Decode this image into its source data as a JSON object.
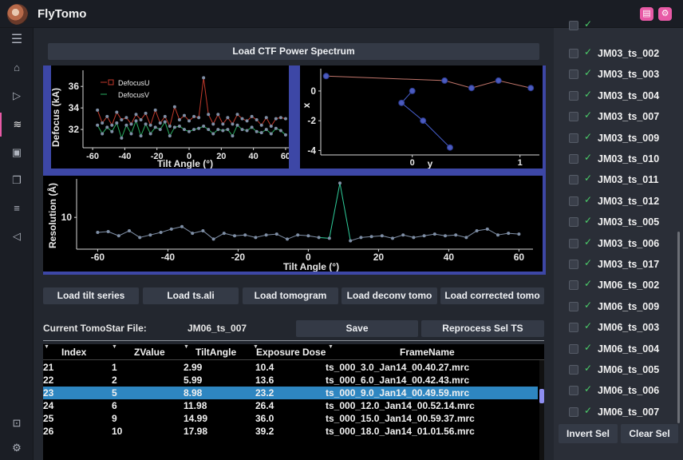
{
  "app": {
    "title": "FlyTomo"
  },
  "header": {
    "icons": [
      "notes-icon",
      "settings-icon"
    ]
  },
  "sidebar": {
    "icons": [
      "menu-icon",
      "home-icon",
      "play-icon",
      "feed-icon",
      "gallery-icon",
      "copy-icon",
      "list-icon",
      "send-icon",
      "save-icon",
      "gear-icon"
    ]
  },
  "main": {
    "load_ctf_label": "Load CTF Power Spectrum",
    "buttons": {
      "load_tilt_series": "Load tilt series",
      "load_ts_ali": "Load ts.ali",
      "load_tomogram": "Load tomogram",
      "load_deconv_tomo": "Load deconv tomo",
      "load_corrected_tomo": "Load corrected tomo",
      "save": "Save",
      "reprocess": "Reprocess Sel TS"
    },
    "current_file_label": "Current TomoStar File:",
    "current_file_value": "JM06_ts_007"
  },
  "defocus_plot": {
    "ylabel": "Defocus (kA)",
    "xlabel": "Tilt Angle (°)",
    "xticks": [
      "-60",
      "-40",
      "-20",
      "0",
      "20",
      "40",
      "60"
    ],
    "yticks": [
      "32",
      "34",
      "36"
    ],
    "legend": [
      "DefocusU",
      "DefocusV"
    ]
  },
  "xy_plot": {
    "xlabel": "y",
    "ylabel": "x",
    "xticks": [
      "0",
      "1"
    ],
    "yticks": [
      "0",
      "-2",
      "-4"
    ]
  },
  "resolution_plot": {
    "ylabel": "Resolution (Å)",
    "xlabel": "Tilt Angle (°)",
    "xticks": [
      "-60",
      "-40",
      "-20",
      "0",
      "20",
      "40",
      "60"
    ],
    "yticks": [
      "10"
    ]
  },
  "table": {
    "headers": [
      "Index",
      "ZValue",
      "TiltAngle",
      "Exposure Dose",
      "FrameName"
    ],
    "rows": [
      {
        "index": "21",
        "z": "1",
        "tilt": "2.99",
        "dose": "10.4",
        "frame": "ts_000_3.0_Jan14_00.40.27.mrc",
        "selected": false
      },
      {
        "index": "22",
        "z": "2",
        "tilt": "5.99",
        "dose": "13.6",
        "frame": "ts_000_6.0_Jan14_00.42.43.mrc",
        "selected": false
      },
      {
        "index": "23",
        "z": "5",
        "tilt": "8.98",
        "dose": "23.2",
        "frame": "ts_000_9.0_Jan14_00.49.59.mrc",
        "selected": true
      },
      {
        "index": "24",
        "z": "6",
        "tilt": "11.98",
        "dose": "26.4",
        "frame": "ts_000_12.0_Jan14_00.52.14.mrc",
        "selected": false
      },
      {
        "index": "25",
        "z": "9",
        "tilt": "14.99",
        "dose": "36.0",
        "frame": "ts_000_15.0_Jan14_00.59.37.mrc",
        "selected": false
      },
      {
        "index": "26",
        "z": "10",
        "tilt": "17.98",
        "dose": "39.2",
        "frame": "ts_000_18.0_Jan14_01.01.56.mrc",
        "selected": false
      }
    ]
  },
  "right_panel": {
    "items": [
      "JM03_ts_002",
      "JM03_ts_003",
      "JM03_ts_004",
      "JM03_ts_007",
      "JM03_ts_009",
      "JM03_ts_010",
      "JM03_ts_011",
      "JM03_ts_012",
      "JM03_ts_005",
      "JM03_ts_006",
      "JM03_ts_017",
      "JM06_ts_002",
      "JM06_ts_009",
      "JM06_ts_003",
      "JM06_ts_004",
      "JM06_ts_005",
      "JM06_ts_006",
      "JM06_ts_007"
    ],
    "check_glyph": "✓",
    "invert_label": "Invert Sel",
    "clear_label": "Clear Sel"
  },
  "chart_data": [
    {
      "type": "line",
      "x": [
        -57,
        -54,
        -51,
        -48,
        -45,
        -42,
        -39,
        -36,
        -33,
        -30,
        -27,
        -24,
        -21,
        -18,
        -15,
        -12,
        -9,
        -6,
        -3,
        0,
        3,
        6,
        9,
        12,
        15,
        18,
        21,
        24,
        27,
        30,
        33,
        36,
        39,
        42,
        45,
        48,
        51,
        54,
        57,
        60
      ],
      "series": [
        {
          "name": "DefocusU",
          "values": [
            33.8,
            32.6,
            33.2,
            32.4,
            33.6,
            32.9,
            33.1,
            32.5,
            33.4,
            32.9,
            33.5,
            32.4,
            33.8,
            32.6,
            33.2,
            32.3,
            34.1,
            32.9,
            33.3,
            32.8,
            33.2,
            33.1,
            36.8,
            33.4,
            32.5,
            33.4,
            32.5,
            33.1,
            32.5,
            33.4,
            33.0,
            32.8,
            33.2,
            32.9,
            32.4,
            33.1,
            32.3,
            33.0,
            33.1,
            33.0
          ]
        },
        {
          "name": "DefocusV",
          "values": [
            32.4,
            31.6,
            32.2,
            31.8,
            32.6,
            31.2,
            32.4,
            31.6,
            32.8,
            31.4,
            32.5,
            31.6,
            32.2,
            32.0,
            32.7,
            31.4,
            32.2,
            32.3,
            32.0,
            31.8,
            32.0,
            32.1,
            32.3,
            32.0,
            31.6,
            32.0,
            31.9,
            32.0,
            31.4,
            32.4,
            32.0,
            31.9,
            32.2,
            31.8,
            31.7,
            32.0,
            31.6,
            32.1,
            31.9,
            31.5
          ]
        }
      ],
      "xlabel": "Tilt Angle (°)",
      "ylabel": "Defocus (kA)",
      "xlim": [
        -66,
        64
      ],
      "ylim": [
        30.3,
        37.5
      ]
    },
    {
      "type": "line",
      "series": [
        {
          "values_xy": [
            [
              -0.8,
              1.0
            ],
            [
              0.3,
              0.7
            ],
            [
              0.55,
              0.2
            ],
            [
              0.8,
              0.7
            ],
            [
              1.1,
              0.2
            ]
          ]
        },
        {
          "values_xy": [
            [
              0.0,
              0.0
            ],
            [
              -0.1,
              -0.8
            ],
            [
              0.1,
              -2.0
            ],
            [
              0.35,
              -3.8
            ]
          ]
        }
      ],
      "xlabel": "y",
      "ylabel": "x",
      "xlim": [
        -0.85,
        1.18
      ],
      "ylim": [
        -4.3,
        1.5
      ]
    },
    {
      "type": "line",
      "x": [
        -60,
        -57,
        -54,
        -51,
        -48,
        -45,
        -42,
        -39,
        -36,
        -33,
        -30,
        -27,
        -24,
        -21,
        -18,
        -15,
        -12,
        -9,
        -6,
        -3,
        0,
        3,
        6,
        9,
        12,
        15,
        18,
        21,
        24,
        27,
        30,
        33,
        36,
        39,
        42,
        45,
        48,
        51,
        54,
        57,
        60
      ],
      "series": [
        {
          "name": "Resolution",
          "values": [
            8.2,
            8.3,
            7.8,
            8.4,
            7.6,
            7.9,
            8.2,
            8.6,
            8.9,
            8.1,
            8.4,
            7.4,
            8.1,
            7.8,
            7.9,
            7.6,
            7.9,
            8.0,
            7.4,
            7.9,
            7.8,
            7.6,
            7.5,
            14.1,
            7.2,
            7.6,
            7.7,
            7.8,
            7.5,
            7.9,
            7.6,
            7.8,
            8.0,
            7.8,
            7.9,
            7.6,
            8.4,
            8.6,
            7.9,
            8.1,
            8.0
          ]
        }
      ],
      "xlabel": "Tilt Angle (°)",
      "ylabel": "Resolution (Å)",
      "xlim": [
        -66,
        64
      ],
      "ylim": [
        6.2,
        14.6
      ]
    }
  ]
}
